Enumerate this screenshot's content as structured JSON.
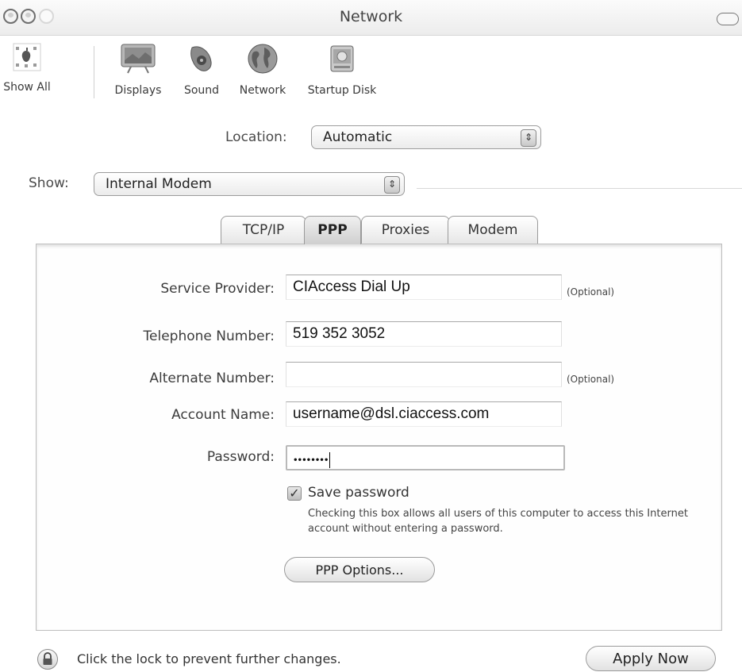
{
  "window": {
    "title": "Network"
  },
  "toolbar": {
    "items": [
      {
        "label": "Show All",
        "icon": "apple-grid-icon"
      },
      {
        "label": "Displays",
        "icon": "display-icon"
      },
      {
        "label": "Sound",
        "icon": "speaker-icon"
      },
      {
        "label": "Network",
        "icon": "globe-icon"
      },
      {
        "label": "Startup Disk",
        "icon": "hard-disk-icon"
      }
    ]
  },
  "location": {
    "label": "Location:",
    "value": "Automatic"
  },
  "show": {
    "label": "Show:",
    "value": "Internal Modem"
  },
  "tabs": [
    {
      "label": "TCP/IP",
      "active": false
    },
    {
      "label": "PPP",
      "active": true
    },
    {
      "label": "Proxies",
      "active": false
    },
    {
      "label": "Modem",
      "active": false
    }
  ],
  "form": {
    "service_provider": {
      "label": "Service Provider:",
      "value": "CIAccess Dial Up",
      "note": "(Optional)"
    },
    "telephone": {
      "label": "Telephone Number:",
      "value": "519 352 3052"
    },
    "alternate": {
      "label": "Alternate Number:",
      "value": "",
      "note": "(Optional)"
    },
    "account": {
      "label": "Account Name:",
      "value": "username@dsl.ciaccess.com"
    },
    "password": {
      "label": "Password:",
      "value": "••••••••"
    },
    "save_password": {
      "label": "Save password",
      "checked": true,
      "help": "Checking this box allows all users of this computer to access this Internet account without entering a password."
    },
    "ppp_options_label": "PPP Options..."
  },
  "footer": {
    "lock_text": "Click the lock to prevent further changes.",
    "apply_label": "Apply Now"
  }
}
